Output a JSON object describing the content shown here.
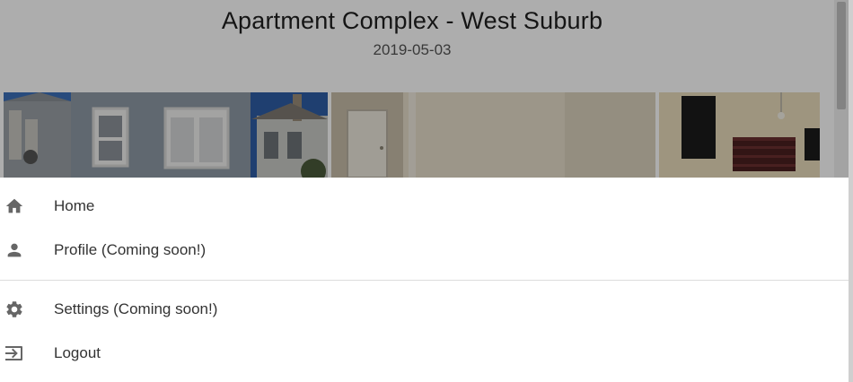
{
  "listing": {
    "title": "Apartment Complex - West Suburb",
    "date": "2019-05-03"
  },
  "menu": {
    "items": [
      {
        "label": "Home",
        "icon": "home-icon"
      },
      {
        "label": "Profile (Coming soon!)",
        "icon": "person-icon"
      },
      {
        "label": "Settings (Coming soon!)",
        "icon": "gear-icon"
      },
      {
        "label": "Logout",
        "icon": "logout-icon"
      }
    ]
  },
  "colors": {
    "scrim": "#000000",
    "icon": "#666666",
    "text": "#333333",
    "divider": "#dcdcdc"
  }
}
